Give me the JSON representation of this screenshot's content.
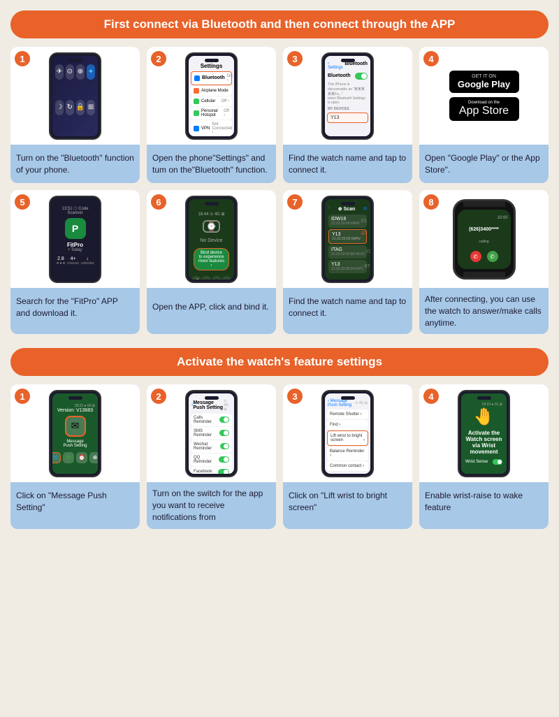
{
  "section1": {
    "header": "First connect via Bluetooth and then connect through the APP",
    "steps": [
      {
        "number": "1",
        "desc": "Turn on the \"Bluetooth\" function of your phone."
      },
      {
        "number": "2",
        "desc": "Open the phone\"Settings\" and tum on the\"Bluetooth\" function."
      },
      {
        "number": "3",
        "desc": "Find the watch name and tap to connect it."
      },
      {
        "number": "4",
        "desc": "Open \"Google Play\" or the App Store\"."
      },
      {
        "number": "5",
        "desc": "Search for the \"FitPro\" APP and download it."
      },
      {
        "number": "6",
        "desc": "Open the APP, click and bind it."
      },
      {
        "number": "7",
        "desc": "Find the watch name and tap to connect it."
      },
      {
        "number": "8",
        "desc": "After connecting, you can use the watch to answer/make calls anytime."
      }
    ],
    "step4": {
      "google_play": "GETIT ON Google Play",
      "app_store": "Download on App Store"
    }
  },
  "section2": {
    "header": "Activate the watch's feature settings",
    "steps": [
      {
        "number": "1",
        "desc": "Click on \"Message Push Setting\""
      },
      {
        "number": "2",
        "desc": "Turn on the switch for the app you want to receive notifications from"
      },
      {
        "number": "3",
        "desc": "Click on \"Lift wrist to bright screen\""
      },
      {
        "number": "4",
        "desc": "Enable wrist-raise to wake feature"
      }
    ]
  },
  "icons": {
    "bluetooth": "✦",
    "wifi": "⊙",
    "airplane": "✈",
    "phone_hang": "✆",
    "phone_answer": "✆",
    "watch": "⌚",
    "message": "✉",
    "hand": "🤚",
    "star": "★",
    "arrow": "›"
  },
  "colors": {
    "accent": "#e8622a",
    "blue_header": "#a8c8e8",
    "background": "#f0ece4",
    "dark": "#1a1a2e",
    "green": "#34c759"
  }
}
